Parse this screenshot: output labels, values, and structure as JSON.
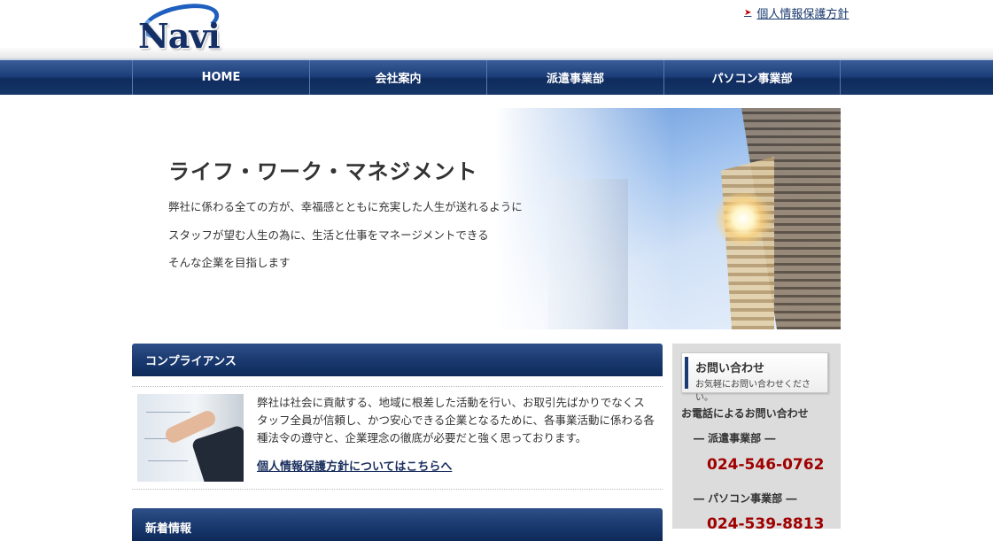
{
  "header": {
    "logo_text": "Navi",
    "privacy_link": "個人情報保護方針"
  },
  "nav": {
    "items": [
      "HOME",
      "会社案内",
      "派遣事業部",
      "パソコン事業部"
    ]
  },
  "hero": {
    "title": "ライフ・ワーク・マネジメント",
    "lines": [
      "弊社に係わる全ての方が、幸福感とともに充実した人生が送れるように",
      "スタッフが望む人生の為に、生活と仕事をマネージメントできる",
      "そんな企業を目指します"
    ]
  },
  "compliance": {
    "heading": "コンプライアンス",
    "text": "弊社は社会に貢献する、地域に根差した活動を行い、お取引先ばかりでなくスタッフ全員が信頼し、かつ安心できる企業となるために、各事業活動に係わる各種法令の遵守と、企業理念の徹底が必要だと強く思っております。",
    "link": "個人情報保護方針についてはこちらへ"
  },
  "news": {
    "heading": "新着情報"
  },
  "sidebar": {
    "contact_title": "お問い合わせ",
    "contact_sub": "お気軽にお問い合わせください。",
    "phone_label": "お電話によるお問い合わせ",
    "departments": [
      {
        "name": "― 派遣事業部 ―",
        "phone": "024-546-0762"
      },
      {
        "name": "― パソコン事業部 ―",
        "phone": "024-539-8813"
      }
    ]
  },
  "colors": {
    "nav_blue": "#1d3f7a",
    "phone_red": "#a00000",
    "arrow_red": "#c00000"
  }
}
